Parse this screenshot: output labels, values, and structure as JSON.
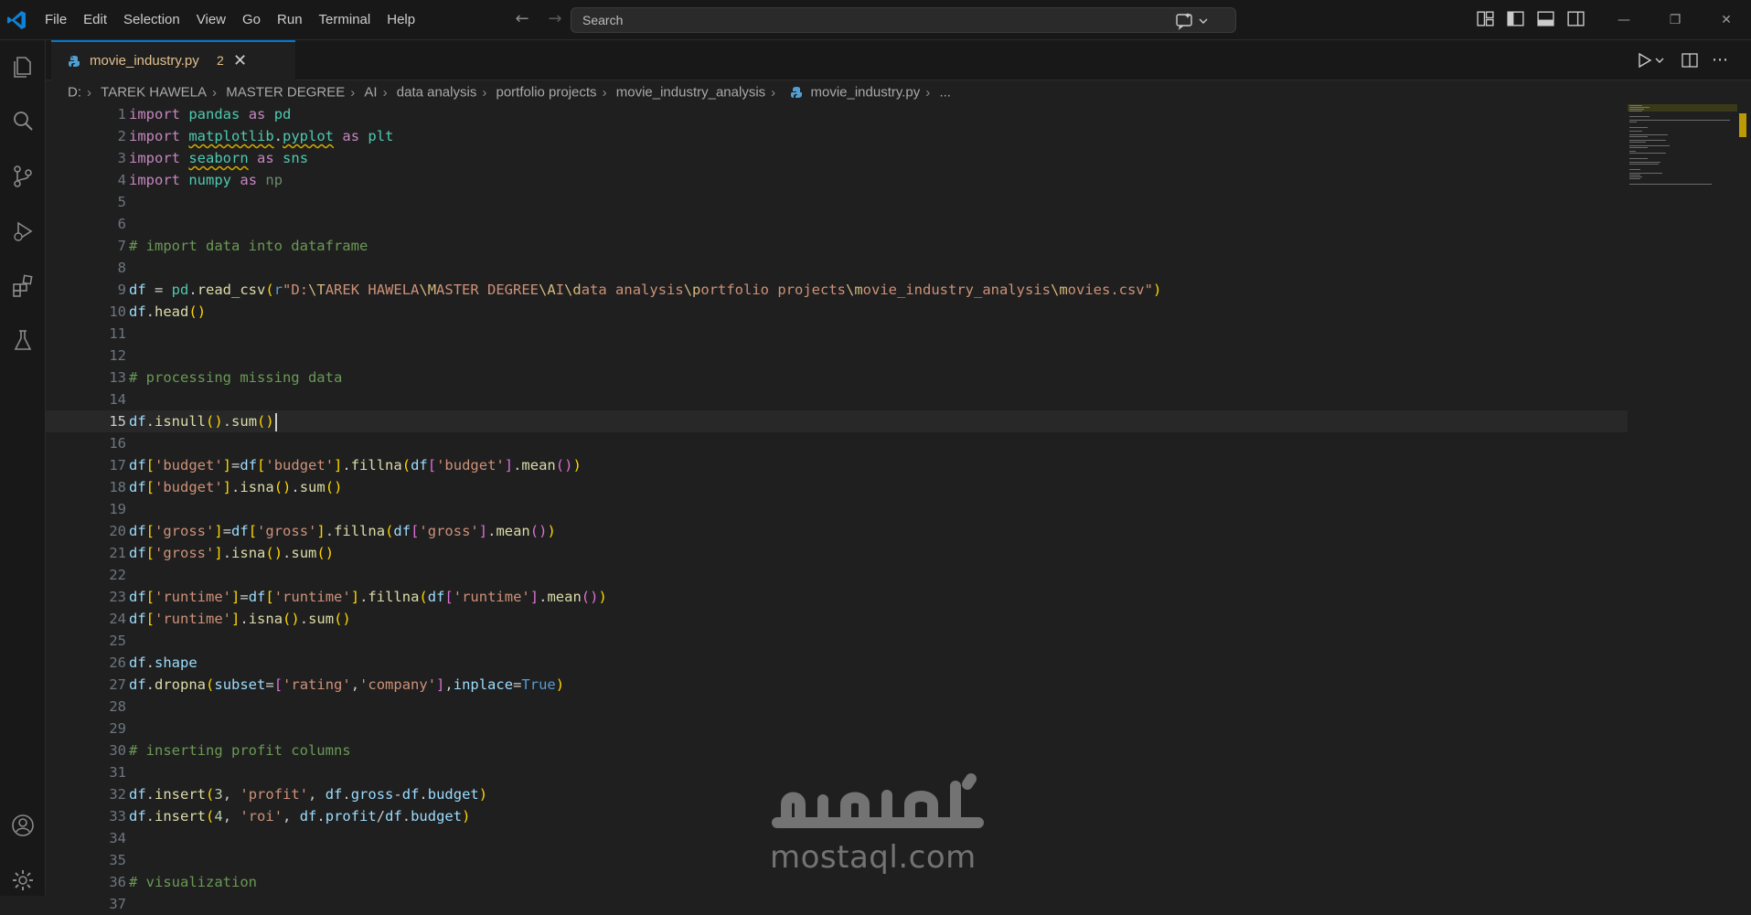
{
  "menu": [
    "File",
    "Edit",
    "Selection",
    "View",
    "Go",
    "Run",
    "Terminal",
    "Help"
  ],
  "search": {
    "placeholder": "Search"
  },
  "tab": {
    "filename": "movie_industry.py",
    "problem_count": "2"
  },
  "breadcrumb": [
    "D:",
    "TAREK HAWELA",
    "MASTER DEGREE",
    "AI",
    "data analysis",
    "portfolio projects",
    "movie_industry_analysis",
    "movie_industry.py",
    "..."
  ],
  "editor": {
    "current_line": 15,
    "lines": [
      "import pandas as pd",
      "import matplotlib.pyplot as plt",
      "import seaborn as sns",
      "import numpy as np",
      "",
      "",
      "# import data into dataframe",
      "",
      "df = pd.read_csv(r\"D:\\TAREK HAWELA\\MASTER DEGREE\\AI\\data analysis\\portfolio projects\\movie_industry_analysis\\movies.csv\")",
      "df.head()",
      "",
      "",
      "# processing missing data",
      "",
      "df.isnull().sum()",
      "",
      "df['budget']=df['budget'].fillna(df['budget'].mean())",
      "df['budget'].isna().sum()",
      "",
      "df['gross']=df['gross'].fillna(df['gross'].mean())",
      "df['gross'].isna().sum()",
      "",
      "df['runtime']=df['runtime'].fillna(df['runtime'].mean())",
      "df['runtime'].isna().sum()",
      "",
      "df.shape",
      "df.dropna(subset=['rating','company'],inplace=True)",
      "",
      "",
      "# inserting profit columns",
      "",
      "df.insert(3, 'profit', df.gross-df.budget)",
      "df.insert(4, 'roi', df.profit/df.budget)",
      "",
      "",
      "# visualization",
      ""
    ]
  },
  "watermark": {
    "arabic": "مستقل",
    "text": "mostaql.com"
  },
  "colors": {
    "accent": "#0078d4",
    "warning": "#e2c08d",
    "background": "#1f1f1f"
  }
}
